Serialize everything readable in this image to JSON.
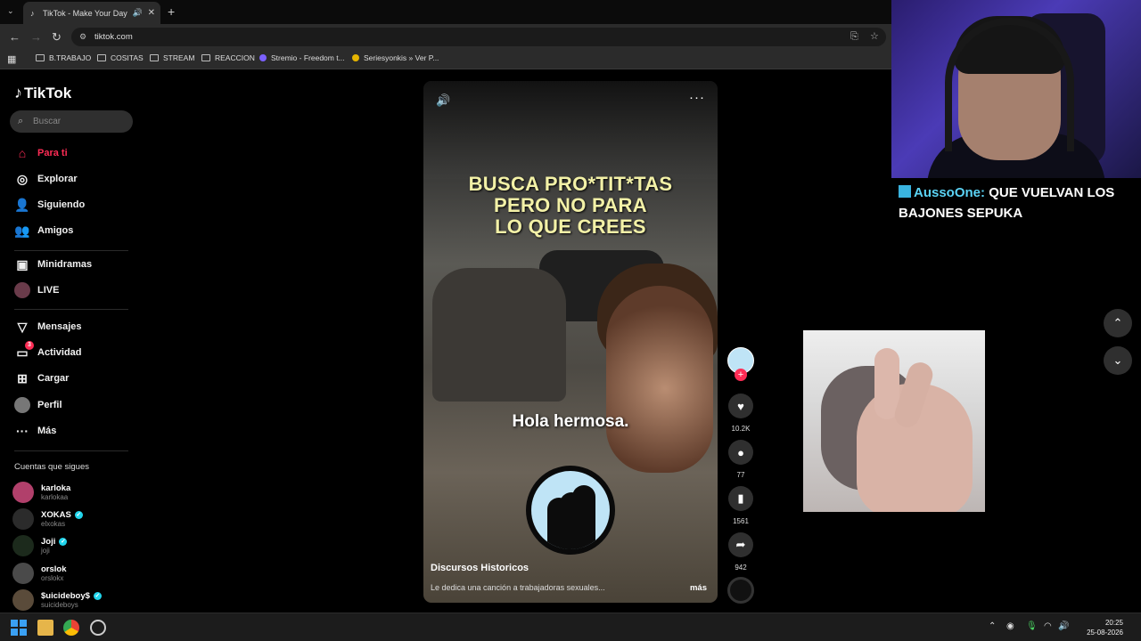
{
  "browser": {
    "tab_title": "TikTok - Make Your Day",
    "url": "tiktok.com",
    "bookmarks": [
      "B.TRABAJO",
      "COSITAS",
      "STREAM",
      "REACCION",
      "Stremio - Freedom t...",
      "Seriesyonkis » Ver P..."
    ]
  },
  "sidebar": {
    "logo": "TikTok",
    "search_placeholder": "Buscar",
    "nav": [
      {
        "label": "Para ti",
        "icon": "home-icon"
      },
      {
        "label": "Explorar",
        "icon": "compass-icon"
      },
      {
        "label": "Siguiendo",
        "icon": "following-icon"
      },
      {
        "label": "Amigos",
        "icon": "friends-icon"
      },
      {
        "label": "Minidramas",
        "icon": "minidrama-icon"
      },
      {
        "label": "LIVE",
        "icon": "live-icon"
      },
      {
        "label": "Mensajes",
        "icon": "messages-icon"
      },
      {
        "label": "Actividad",
        "icon": "activity-icon"
      },
      {
        "label": "Cargar",
        "icon": "upload-icon"
      },
      {
        "label": "Perfil",
        "icon": "profile-icon"
      },
      {
        "label": "Más",
        "icon": "more-icon"
      }
    ],
    "activity_badge": "3",
    "following_title": "Cuentas que sigues",
    "accounts": [
      {
        "name": "karloka",
        "handle": "karlokaa",
        "verified": false
      },
      {
        "name": "XOKAS",
        "handle": "elxokas",
        "verified": true
      },
      {
        "name": "Joji",
        "handle": "joji",
        "verified": true
      },
      {
        "name": "orslok",
        "handle": "orslokx",
        "verified": false
      },
      {
        "name": "$uicideboy$",
        "handle": "suicideboys",
        "verified": true
      }
    ]
  },
  "video": {
    "caption_top": [
      "BUSCA PRO*TIT*TAS",
      "PERO NO PARA",
      "LO QUE CREES"
    ],
    "caption_mid": "Hola hermosa.",
    "author": "Discursos Historicos",
    "description": "Le dedica una canción a trabajadoras sexuales...",
    "more_label": "más"
  },
  "actions": {
    "likes": "10.2K",
    "comments": "77",
    "saves": "1561",
    "shares": "942"
  },
  "stream_overlay": {
    "chat_user": "AussoOne:",
    "chat_message": "QUE VUELVAN LOS BAJONES SEPUKA"
  },
  "taskbar": {
    "time": "20:25",
    "date": "25-08-2026"
  },
  "colors": {
    "accent": "#fe2c55",
    "caption_yellow": "#f3f1a7",
    "chat_user": "#5bd3f5"
  }
}
